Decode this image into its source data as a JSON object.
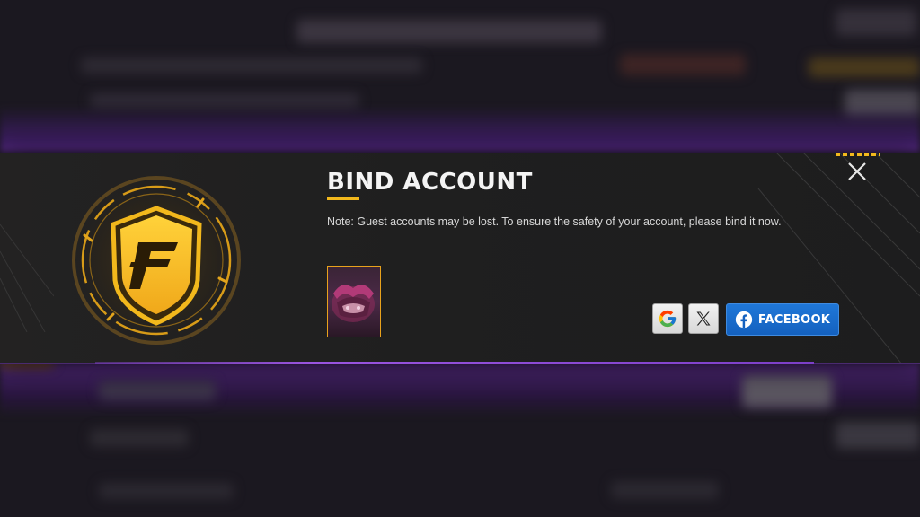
{
  "dialog": {
    "title": "BIND ACCOUNT",
    "note": "Note: Guest accounts may be lost. To ensure the safety of your account, please bind it now."
  },
  "login_options": {
    "facebook_label": "FACEBOOK"
  },
  "colors": {
    "accent": "#f2b81c",
    "facebook": "#1461bf",
    "panel": "#1f1f1f",
    "purple_glow": "#9a55e0"
  },
  "icons": {
    "emblem": "free-fire-shield-emblem-icon",
    "reward": "reward-item-icon",
    "google": "google-icon",
    "x": "x-logo-icon",
    "facebook": "facebook-icon",
    "close": "close-icon"
  }
}
